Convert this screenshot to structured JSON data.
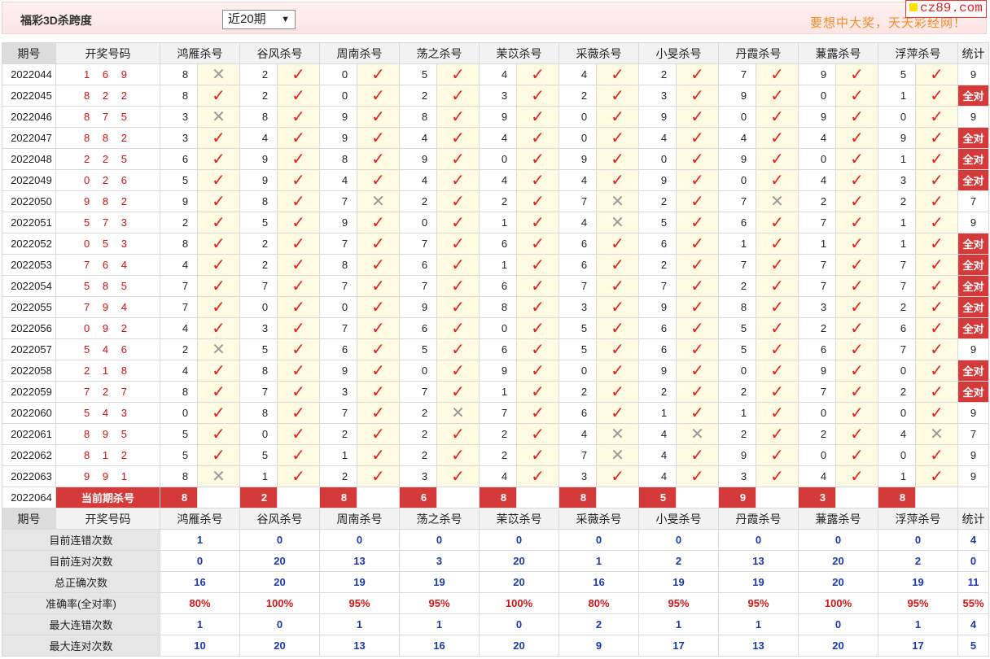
{
  "header": {
    "title": "福彩3D杀跨度",
    "period_select": "近20期",
    "slogan": "要想中大奖，天天彩经网！",
    "logo": "cz89.com"
  },
  "table": {
    "col_period": "期号",
    "col_draw": "开奖号码",
    "experts": [
      "鸿雁杀号",
      "谷风杀号",
      "周南杀号",
      "荡之杀号",
      "茉苡杀号",
      "采薇杀号",
      "小旻杀号",
      "丹霞杀号",
      "蒹露杀号",
      "浮萍杀号"
    ],
    "col_stat": "统计",
    "rows": [
      {
        "period": "2022044",
        "draw": "1 6 9",
        "picks": [
          "8",
          "2",
          "0",
          "5",
          "4",
          "4",
          "2",
          "7",
          "9",
          "5"
        ],
        "hits": [
          0,
          1,
          1,
          1,
          1,
          1,
          1,
          1,
          1,
          1
        ],
        "stat": "9"
      },
      {
        "period": "2022045",
        "draw": "8 2 2",
        "picks": [
          "8",
          "2",
          "0",
          "2",
          "3",
          "2",
          "3",
          "9",
          "0",
          "1"
        ],
        "hits": [
          1,
          1,
          1,
          1,
          1,
          1,
          1,
          1,
          1,
          1
        ],
        "stat": "全对"
      },
      {
        "period": "2022046",
        "draw": "8 7 5",
        "picks": [
          "3",
          "8",
          "9",
          "8",
          "9",
          "0",
          "9",
          "0",
          "9",
          "0"
        ],
        "hits": [
          0,
          1,
          1,
          1,
          1,
          1,
          1,
          1,
          1,
          1
        ],
        "stat": "9"
      },
      {
        "period": "2022047",
        "draw": "8 8 2",
        "picks": [
          "3",
          "4",
          "9",
          "4",
          "4",
          "0",
          "4",
          "4",
          "4",
          "9"
        ],
        "hits": [
          1,
          1,
          1,
          1,
          1,
          1,
          1,
          1,
          1,
          1
        ],
        "stat": "全对"
      },
      {
        "period": "2022048",
        "draw": "2 2 5",
        "picks": [
          "6",
          "9",
          "8",
          "9",
          "0",
          "9",
          "0",
          "9",
          "0",
          "1"
        ],
        "hits": [
          1,
          1,
          1,
          1,
          1,
          1,
          1,
          1,
          1,
          1
        ],
        "stat": "全对"
      },
      {
        "period": "2022049",
        "draw": "0 2 6",
        "picks": [
          "5",
          "9",
          "4",
          "4",
          "4",
          "4",
          "9",
          "0",
          "4",
          "3"
        ],
        "hits": [
          1,
          1,
          1,
          1,
          1,
          1,
          1,
          1,
          1,
          1
        ],
        "stat": "全对"
      },
      {
        "period": "2022050",
        "draw": "9 8 2",
        "picks": [
          "9",
          "8",
          "7",
          "2",
          "2",
          "7",
          "2",
          "7",
          "2",
          "2"
        ],
        "hits": [
          1,
          1,
          0,
          1,
          1,
          0,
          1,
          0,
          1,
          1
        ],
        "stat": "7"
      },
      {
        "period": "2022051",
        "draw": "5 7 3",
        "picks": [
          "2",
          "5",
          "9",
          "0",
          "1",
          "4",
          "5",
          "6",
          "7",
          "1"
        ],
        "hits": [
          1,
          1,
          1,
          1,
          1,
          0,
          1,
          1,
          1,
          1
        ],
        "stat": "9"
      },
      {
        "period": "2022052",
        "draw": "0 5 3",
        "picks": [
          "8",
          "2",
          "7",
          "7",
          "6",
          "6",
          "6",
          "1",
          "1",
          "1"
        ],
        "hits": [
          1,
          1,
          1,
          1,
          1,
          1,
          1,
          1,
          1,
          1
        ],
        "stat": "全对"
      },
      {
        "period": "2022053",
        "draw": "7 6 4",
        "picks": [
          "4",
          "2",
          "8",
          "6",
          "1",
          "6",
          "2",
          "7",
          "7",
          "7"
        ],
        "hits": [
          1,
          1,
          1,
          1,
          1,
          1,
          1,
          1,
          1,
          1
        ],
        "stat": "全对"
      },
      {
        "period": "2022054",
        "draw": "5 8 5",
        "picks": [
          "7",
          "7",
          "7",
          "7",
          "6",
          "7",
          "7",
          "2",
          "7",
          "7"
        ],
        "hits": [
          1,
          1,
          1,
          1,
          1,
          1,
          1,
          1,
          1,
          1
        ],
        "stat": "全对"
      },
      {
        "period": "2022055",
        "draw": "7 9 4",
        "picks": [
          "7",
          "0",
          "0",
          "9",
          "8",
          "3",
          "9",
          "8",
          "3",
          "2"
        ],
        "hits": [
          1,
          1,
          1,
          1,
          1,
          1,
          1,
          1,
          1,
          1
        ],
        "stat": "全对"
      },
      {
        "period": "2022056",
        "draw": "0 9 2",
        "picks": [
          "4",
          "3",
          "7",
          "6",
          "0",
          "5",
          "6",
          "5",
          "2",
          "6"
        ],
        "hits": [
          1,
          1,
          1,
          1,
          1,
          1,
          1,
          1,
          1,
          1
        ],
        "stat": "全对"
      },
      {
        "period": "2022057",
        "draw": "5 4 6",
        "picks": [
          "2",
          "5",
          "6",
          "5",
          "6",
          "5",
          "6",
          "5",
          "6",
          "7"
        ],
        "hits": [
          0,
          1,
          1,
          1,
          1,
          1,
          1,
          1,
          1,
          1
        ],
        "stat": "9"
      },
      {
        "period": "2022058",
        "draw": "2 1 8",
        "picks": [
          "4",
          "8",
          "9",
          "0",
          "9",
          "0",
          "9",
          "0",
          "9",
          "0"
        ],
        "hits": [
          1,
          1,
          1,
          1,
          1,
          1,
          1,
          1,
          1,
          1
        ],
        "stat": "全对"
      },
      {
        "period": "2022059",
        "draw": "7 2 7",
        "picks": [
          "8",
          "7",
          "3",
          "7",
          "1",
          "2",
          "2",
          "2",
          "7",
          "2"
        ],
        "hits": [
          1,
          1,
          1,
          1,
          1,
          1,
          1,
          1,
          1,
          1
        ],
        "stat": "全对"
      },
      {
        "period": "2022060",
        "draw": "5 4 3",
        "picks": [
          "0",
          "8",
          "7",
          "2",
          "7",
          "6",
          "1",
          "1",
          "0",
          "0"
        ],
        "hits": [
          1,
          1,
          1,
          0,
          1,
          1,
          1,
          1,
          1,
          1
        ],
        "stat": "9"
      },
      {
        "period": "2022061",
        "draw": "8 9 5",
        "picks": [
          "5",
          "0",
          "2",
          "2",
          "2",
          "4",
          "4",
          "2",
          "2",
          "4"
        ],
        "hits": [
          1,
          1,
          1,
          1,
          1,
          0,
          0,
          1,
          1,
          0
        ],
        "stat": "7"
      },
      {
        "period": "2022062",
        "draw": "8 1 2",
        "picks": [
          "5",
          "5",
          "1",
          "2",
          "2",
          "7",
          "4",
          "9",
          "0",
          "0"
        ],
        "hits": [
          1,
          1,
          1,
          1,
          1,
          0,
          1,
          1,
          1,
          1
        ],
        "stat": "9"
      },
      {
        "period": "2022063",
        "draw": "9 9 1",
        "picks": [
          "8",
          "1",
          "2",
          "3",
          "4",
          "3",
          "4",
          "3",
          "4",
          "1"
        ],
        "hits": [
          0,
          1,
          1,
          1,
          1,
          1,
          1,
          1,
          1,
          1
        ],
        "stat": "9"
      }
    ],
    "current": {
      "period": "2022064",
      "label": "当前期杀号",
      "picks": [
        "8",
        "2",
        "8",
        "6",
        "8",
        "8",
        "5",
        "9",
        "3",
        "8"
      ]
    },
    "summary": [
      {
        "label": "目前连错次数",
        "values": [
          "1",
          "0",
          "0",
          "0",
          "0",
          "0",
          "0",
          "0",
          "0",
          "0"
        ],
        "stat": "4",
        "color": "blue"
      },
      {
        "label": "目前连对次数",
        "values": [
          "0",
          "20",
          "13",
          "3",
          "20",
          "1",
          "2",
          "13",
          "20",
          "2"
        ],
        "stat": "0",
        "color": "blue"
      },
      {
        "label": "总正确次数",
        "values": [
          "16",
          "20",
          "19",
          "19",
          "20",
          "16",
          "19",
          "19",
          "20",
          "19"
        ],
        "stat": "11",
        "color": "blue"
      },
      {
        "label": "准确率(全对率)",
        "values": [
          "80%",
          "100%",
          "95%",
          "95%",
          "100%",
          "80%",
          "95%",
          "95%",
          "100%",
          "95%"
        ],
        "stat": "55%",
        "color": "red"
      },
      {
        "label": "最大连错次数",
        "values": [
          "1",
          "0",
          "1",
          "1",
          "0",
          "2",
          "1",
          "1",
          "0",
          "1"
        ],
        "stat": "4",
        "color": "blue"
      },
      {
        "label": "最大连对次数",
        "values": [
          "10",
          "20",
          "13",
          "16",
          "20",
          "9",
          "17",
          "13",
          "20",
          "17"
        ],
        "stat": "5",
        "color": "blue"
      }
    ],
    "marks": {
      "hit": "✓",
      "miss": "✕"
    }
  }
}
